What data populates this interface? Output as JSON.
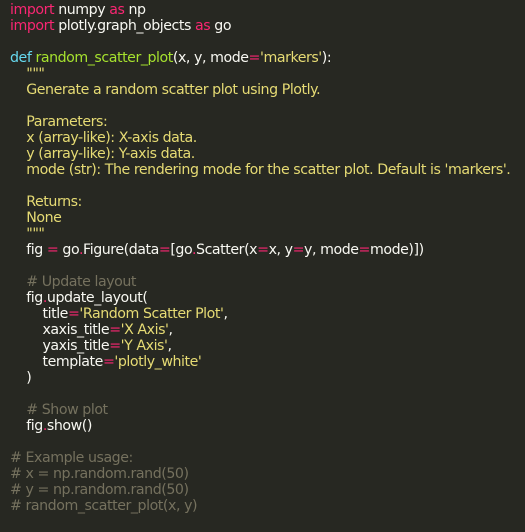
{
  "colors": {
    "background": "#272822",
    "keyword": "#f92672",
    "def_keyword": "#66d9ef",
    "function_name": "#a6e22e",
    "string": "#e6db74",
    "comment": "#75715e",
    "plain": "#f8f8f2"
  },
  "code": {
    "l1": {
      "a": "import",
      "b": " numpy ",
      "c": "as",
      "d": " np"
    },
    "l2": {
      "a": "import",
      "b": " plotly.graph_objects ",
      "c": "as",
      "d": " go"
    },
    "l4": {
      "a": "def",
      "b": " ",
      "c": "random_scatter_plot",
      "d": "(x, y, mode",
      "e": "=",
      "f": "'markers'",
      "g": "):"
    },
    "l5": {
      "a": "    \"\"\""
    },
    "l6": {
      "a": "    Generate a random scatter plot using Plotly."
    },
    "l8": {
      "a": "    Parameters:"
    },
    "l9": {
      "a": "    x (array-like): X-axis data."
    },
    "l10": {
      "a": "    y (array-like): Y-axis data."
    },
    "l11": {
      "a": "    mode (str): The rendering mode for the scatter plot. Default is 'markers'."
    },
    "l13": {
      "a": "    Returns:"
    },
    "l14": {
      "a": "    None"
    },
    "l15": {
      "a": "    \"\"\""
    },
    "l16": {
      "a": "    fig ",
      "b": "=",
      "c": " go",
      "d": ".",
      "e": "Figure(data",
      "f": "=",
      "g": "[go",
      "h": ".",
      "i": "Scatter(x",
      "j": "=",
      "k": "x, y",
      "l": "=",
      "m": "y, mode",
      "n": "=",
      "o": "mode)])"
    },
    "l18": {
      "a": "    # Update layout"
    },
    "l19": {
      "a": "    fig",
      "b": ".",
      "c": "update_layout("
    },
    "l20": {
      "a": "        title",
      "b": "=",
      "c": "'Random Scatter Plot'",
      "d": ","
    },
    "l21": {
      "a": "        xaxis_title",
      "b": "=",
      "c": "'X Axis'",
      "d": ","
    },
    "l22": {
      "a": "        yaxis_title",
      "b": "=",
      "c": "'Y Axis'",
      "d": ","
    },
    "l23": {
      "a": "        template",
      "b": "=",
      "c": "'plotly_white'"
    },
    "l24": {
      "a": "    )"
    },
    "l26": {
      "a": "    # Show plot"
    },
    "l27": {
      "a": "    fig",
      "b": ".",
      "c": "show()"
    },
    "l29": {
      "a": "# Example usage:"
    },
    "l30": {
      "a": "# x = np.random.rand(50)"
    },
    "l31": {
      "a": "# y = np.random.rand(50)"
    },
    "l32": {
      "a": "# random_scatter_plot(x, y)"
    }
  }
}
